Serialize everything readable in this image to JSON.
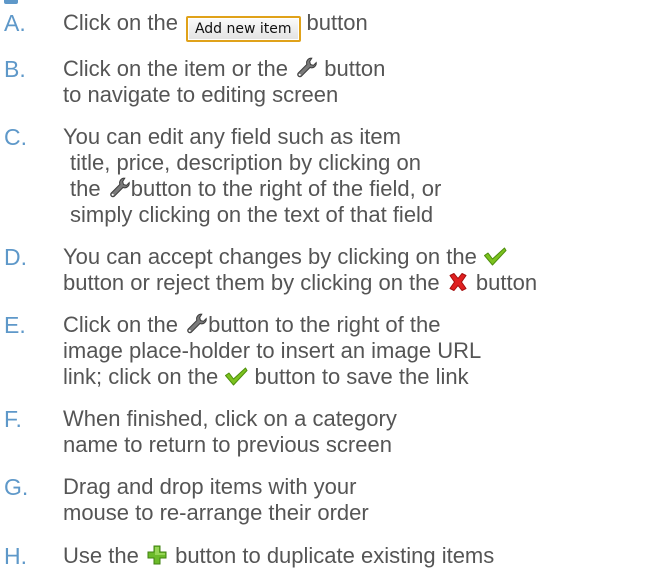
{
  "steps": [
    {
      "letter": "A.",
      "before": "Click on the",
      "button_label": "Add new item",
      "after": "button"
    },
    {
      "letter": "B.",
      "l1_before": "Click on the item or the",
      "l1_after": "button",
      "l2": "to navigate to editing screen"
    },
    {
      "letter": "C.",
      "l1": "You can edit any field such as item",
      "l2": "title, price, description by clicking on",
      "l3_before": "the",
      "l3_after": "button to the right of the field, or",
      "l4": "simply clicking on the text of that field"
    },
    {
      "letter": "D.",
      "l1_before": "You can accept changes by clicking on the",
      "l2_before": "button or reject them by clicking on the",
      "l2_after": "button"
    },
    {
      "letter": "E.",
      "l1_before": "Click on the",
      "l1_after": "button to the right of the",
      "l2": "image place-holder to insert an image URL",
      "l3_before": "link; click on the",
      "l3_after": "button to save the link"
    },
    {
      "letter": "F.",
      "l1": "When finished, click on a category",
      "l2": "name to return to previous screen"
    },
    {
      "letter": "G.",
      "l1": "Drag and drop items with your",
      "l2": "mouse to re-arrange their order"
    },
    {
      "letter": "H.",
      "l1_before": "Use the",
      "l1_after": "button to duplicate existing items"
    }
  ],
  "icons": {
    "edit": "wrench-icon",
    "accept": "checkmark-icon",
    "reject": "red-x-icon",
    "duplicate": "green-plus-icon"
  },
  "colors": {
    "letter": "#5e98c9",
    "text": "#555555",
    "button_border": "#e0a21a",
    "accept": "#7cc21f",
    "reject": "#d81d1d",
    "duplicate": "#6cbb2a"
  }
}
